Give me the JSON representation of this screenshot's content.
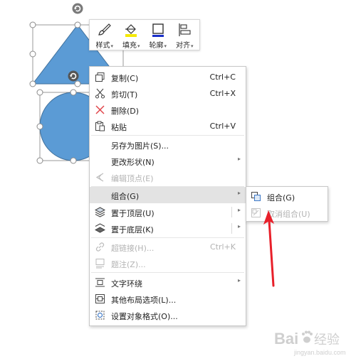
{
  "mini_toolbar": {
    "buttons": [
      {
        "label": "样式",
        "icon": "brush-icon"
      },
      {
        "label": "填充",
        "icon": "fill-bucket-icon"
      },
      {
        "label": "轮廓",
        "icon": "outline-icon"
      },
      {
        "label": "对齐",
        "icon": "align-icon"
      }
    ]
  },
  "context_menu": {
    "items": [
      {
        "label": "复制(C)",
        "shortcut": "Ctrl+C",
        "icon": "copy-icon"
      },
      {
        "label": "剪切(T)",
        "shortcut": "Ctrl+X",
        "icon": "cut-icon"
      },
      {
        "label": "删除(D)",
        "shortcut": "",
        "icon": "delete-icon"
      },
      {
        "label": "粘贴",
        "shortcut": "Ctrl+V",
        "icon": "paste-icon"
      },
      {
        "label": "另存为图片(S)...",
        "shortcut": "",
        "icon": ""
      },
      {
        "label": "更改形状(N)",
        "shortcut": "",
        "icon": ""
      },
      {
        "label": "编辑顶点(E)",
        "shortcut": "",
        "icon": "edit-points-icon"
      },
      {
        "label": "组合(G)",
        "shortcut": "",
        "icon": ""
      },
      {
        "label": "置于顶层(U)",
        "shortcut": "",
        "icon": "bring-to-front-icon"
      },
      {
        "label": "置于底层(K)",
        "shortcut": "",
        "icon": "send-to-back-icon"
      },
      {
        "label": "超链接(H)...",
        "shortcut": "Ctrl+K",
        "icon": "hyperlink-icon"
      },
      {
        "label": "题注(Z)...",
        "shortcut": "",
        "icon": "caption-icon"
      },
      {
        "label": "文字环绕",
        "shortcut": "",
        "icon": "text-wrap-icon"
      },
      {
        "label": "其他布局选项(L)...",
        "shortcut": "",
        "icon": "layout-options-icon"
      },
      {
        "label": "设置对象格式(O)...",
        "shortcut": "",
        "icon": "format-object-icon"
      }
    ]
  },
  "submenu": {
    "items": [
      {
        "label": "组合(G)",
        "icon": "group-icon"
      },
      {
        "label": "取消组合(U)",
        "icon": "ungroup-icon"
      }
    ]
  },
  "colors": {
    "shape_fill": "#5b9bd5",
    "shape_stroke": "#41719c",
    "annotation": "#e8202a",
    "menu_highlight": "#e3e3e3"
  },
  "watermark": {
    "text": "Bai",
    "suffix": "经验",
    "domain": "jingyan.baidu.com"
  }
}
